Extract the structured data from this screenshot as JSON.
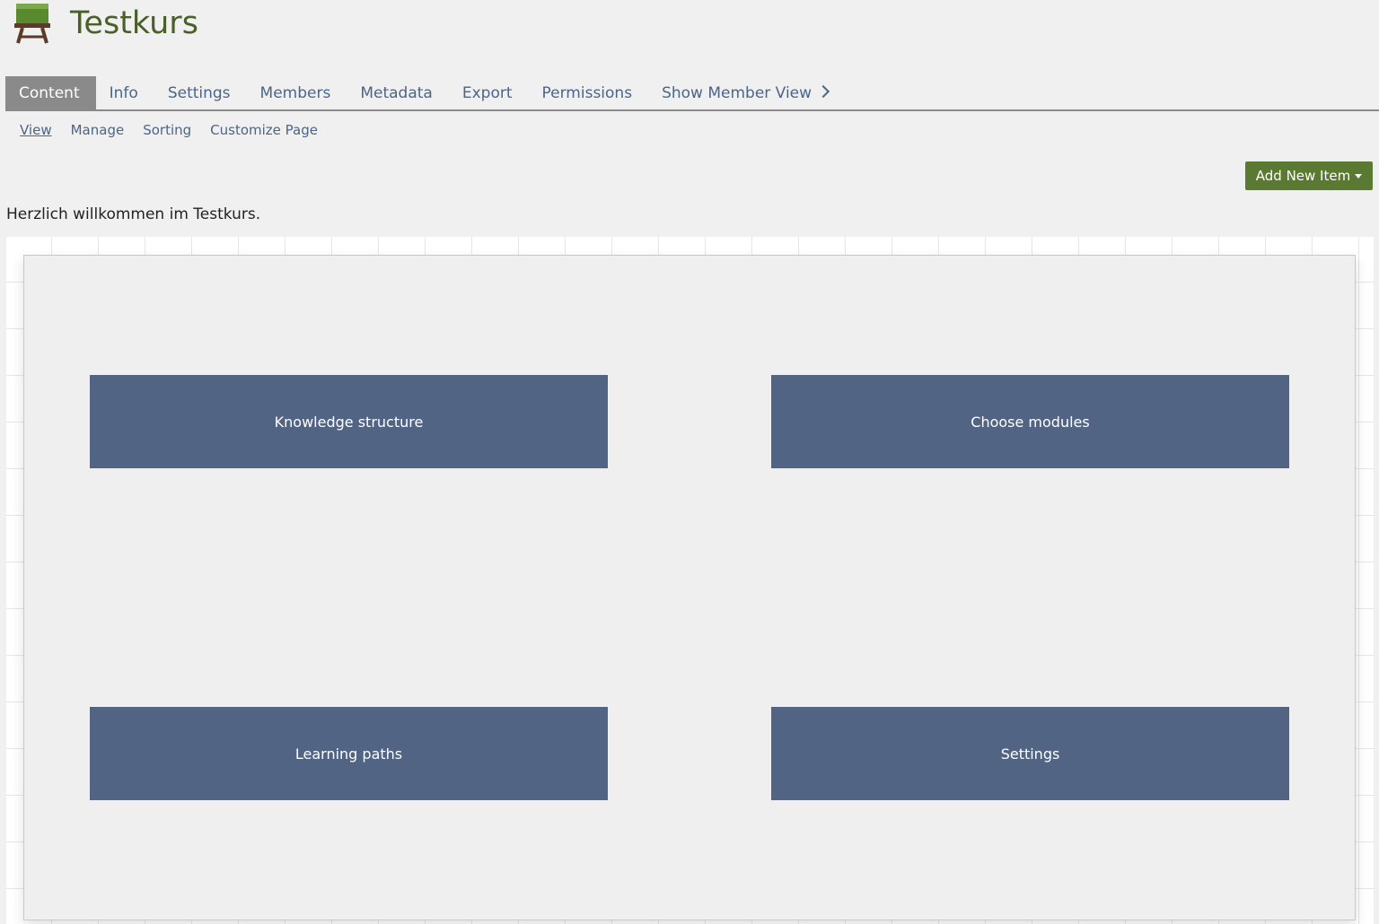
{
  "course": {
    "title": "Testkurs",
    "icon": "course-board-icon"
  },
  "tabs": [
    {
      "label": "Content",
      "active": true
    },
    {
      "label": "Info",
      "active": false
    },
    {
      "label": "Settings",
      "active": false
    },
    {
      "label": "Members",
      "active": false
    },
    {
      "label": "Metadata",
      "active": false
    },
    {
      "label": "Export",
      "active": false
    },
    {
      "label": "Permissions",
      "active": false
    },
    {
      "label": "Show Member View",
      "active": false
    }
  ],
  "subtabs": [
    {
      "label": "View",
      "active": true
    },
    {
      "label": "Manage",
      "active": false
    },
    {
      "label": "Sorting",
      "active": false
    },
    {
      "label": "Customize Page",
      "active": false
    }
  ],
  "toolbar": {
    "add_new_item": "Add New Item"
  },
  "welcome_text": "Herzlich willkommen im Testkurs.",
  "modules": [
    {
      "label": "Knowledge structure"
    },
    {
      "label": "Choose modules"
    },
    {
      "label": "Learning paths"
    },
    {
      "label": "Settings"
    }
  ],
  "colors": {
    "title_green": "#4a5f2a",
    "button_green": "#5a7a32",
    "active_tab_gray": "#8a8a8a",
    "link_blue": "#4c6586",
    "module_blue": "#526484"
  }
}
